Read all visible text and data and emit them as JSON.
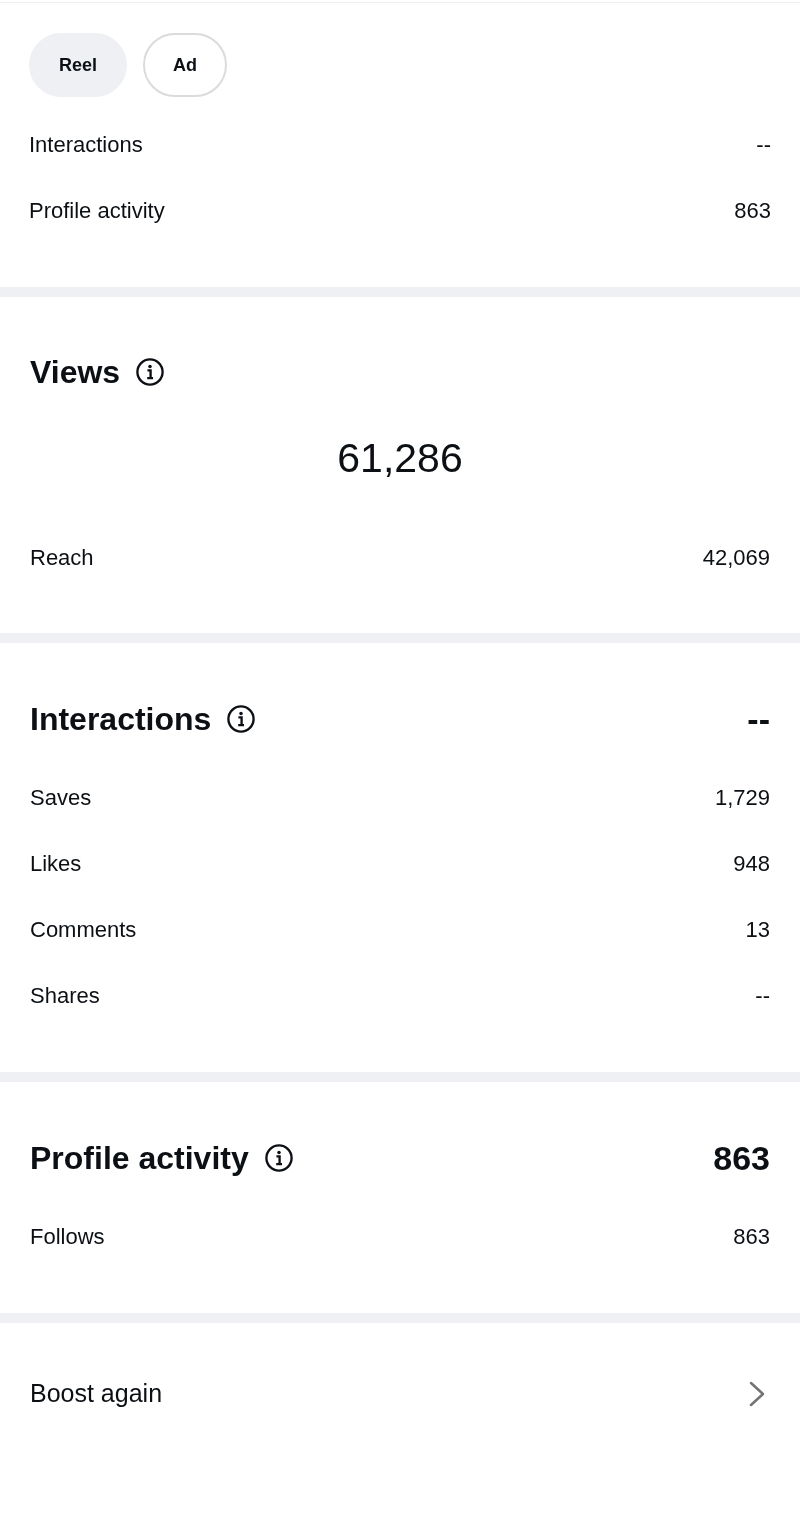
{
  "filter_chips": [
    {
      "label": "Reel",
      "selected": true
    },
    {
      "label": "Ad",
      "selected": false
    }
  ],
  "summary_rows": [
    {
      "label": "Interactions",
      "value": "--"
    },
    {
      "label": "Profile activity",
      "value": "863"
    }
  ],
  "sections": [
    {
      "kind": "centered_total",
      "title": "Views",
      "total": "61,286",
      "rows": [
        {
          "label": "Reach",
          "value": "42,069"
        }
      ]
    },
    {
      "kind": "heading_total",
      "title": "Interactions",
      "total": "--",
      "rows": [
        {
          "label": "Saves",
          "value": "1,729"
        },
        {
          "label": "Likes",
          "value": "948"
        },
        {
          "label": "Comments",
          "value": "13"
        },
        {
          "label": "Shares",
          "value": "--"
        }
      ]
    },
    {
      "kind": "heading_total",
      "title": "Profile activity",
      "total": "863",
      "rows": [
        {
          "label": "Follows",
          "value": "863"
        }
      ]
    }
  ],
  "boost_link": {
    "label": "Boost again"
  }
}
